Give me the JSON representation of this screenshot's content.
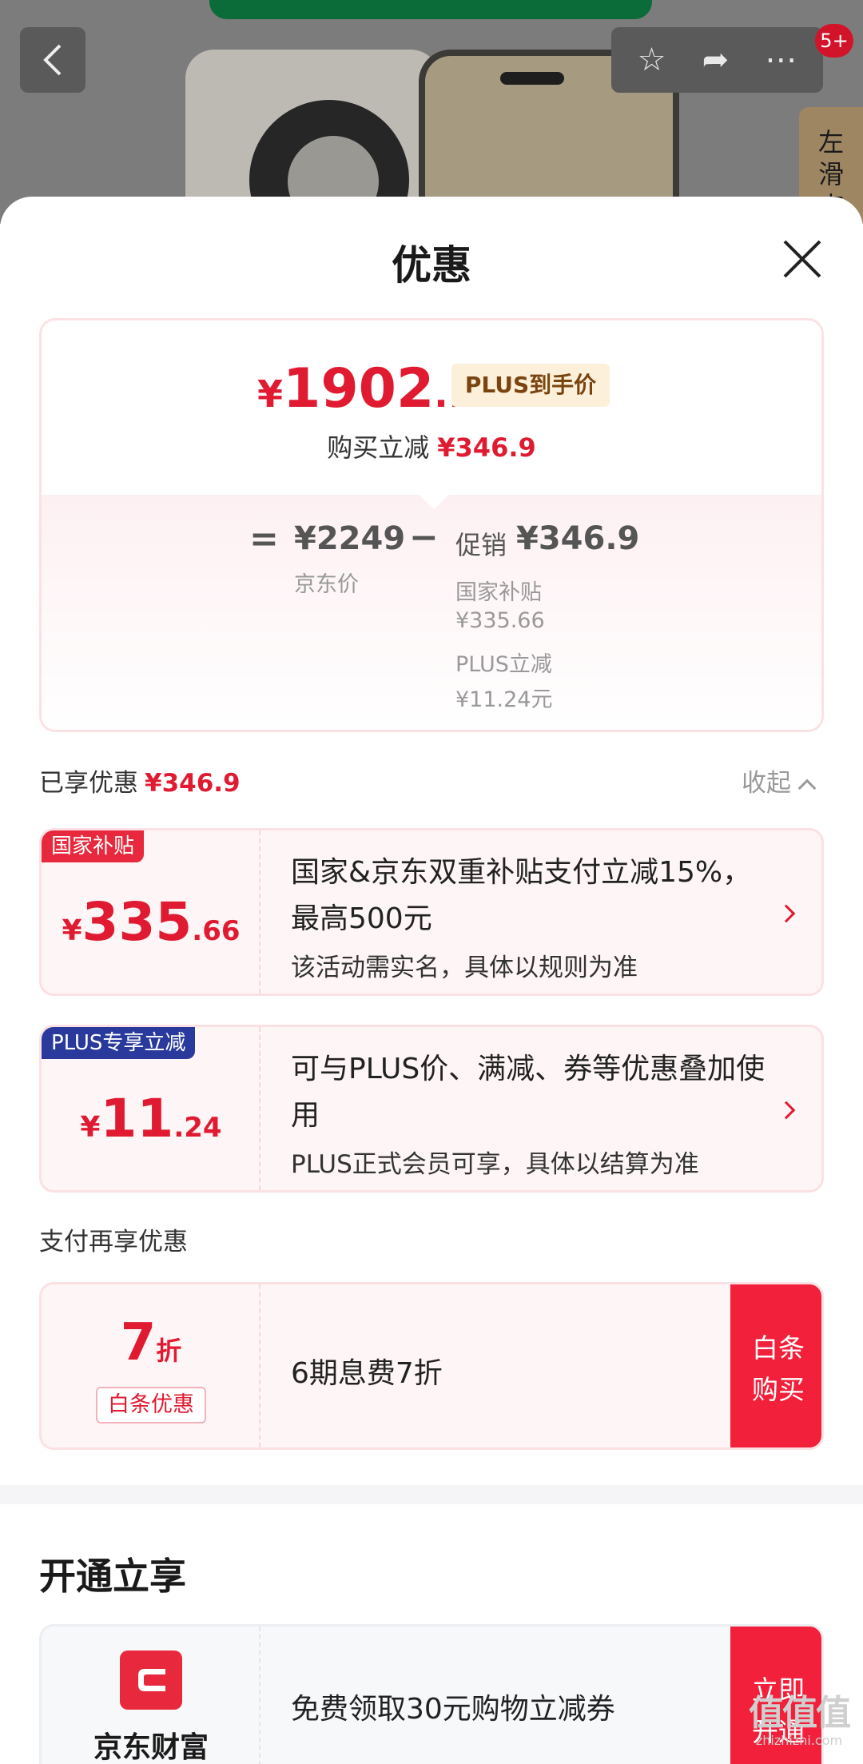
{
  "background": {
    "side_tab_text": "左滑查",
    "badge": "5+"
  },
  "sheet": {
    "title": "优惠",
    "summary": {
      "final_price_yen": "¥",
      "final_price_int": "1902",
      "final_price_dec": ".1",
      "price_tag": "PLUS到手价",
      "direct_reduce_label": "购买立减",
      "direct_reduce_value": "¥346.9",
      "equals": "=",
      "jd_price": "¥2249",
      "jd_price_label": "京东价",
      "minus": "−",
      "promo_label": "促销",
      "promo_value": "¥346.9",
      "breakdown": [
        {
          "label": "国家补贴",
          "value": "¥335.66"
        },
        {
          "label": "PLUS立减",
          "value": "¥11.24元"
        }
      ]
    },
    "enjoyed": {
      "label": "已享优惠",
      "value": "¥346.9",
      "collapse_label": "收起"
    },
    "coupons": [
      {
        "tag": "国家补贴",
        "tag_color": "#e8283c",
        "yen": "¥",
        "amount_int": "335",
        "amount_dec": ".66",
        "desc": "国家&京东双重补贴支付立减15%，最高500元",
        "note": "该活动需实名，具体以规则为准"
      },
      {
        "tag": "PLUS专享立减",
        "tag_color": "#2a3a9c",
        "yen": "¥",
        "amount_int": "11",
        "amount_dec": ".24",
        "desc": "可与PLUS价、满减、券等优惠叠加使用",
        "note": "PLUS正式会员可享，具体以结算为准"
      }
    ],
    "pay_section": {
      "label": "支付再享优惠",
      "discount_num": "7",
      "discount_unit": "折",
      "tag": "白条优惠",
      "text": "6期息费7折",
      "button_line1": "白条",
      "button_line2": "购买"
    },
    "open_section": {
      "title": "开通立享",
      "brand": "京东财富",
      "text": "免费领取30元购物立减券",
      "button_line1": "立即",
      "button_line2": "开通"
    }
  },
  "watermark": {
    "main": "值值值",
    "sub": "zhizhizhi.com"
  },
  "colors": {
    "accent_red": "#e01b31",
    "plus_blue": "#2a3a9c",
    "button_red": "#f2203a"
  }
}
